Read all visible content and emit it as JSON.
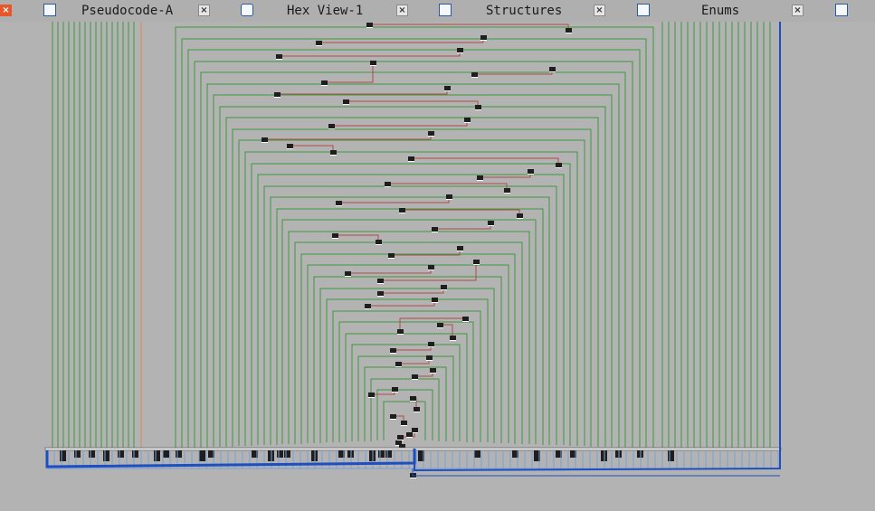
{
  "window": {
    "active_close_label": "×"
  },
  "tabs": [
    {
      "label": "Pseudocode-A",
      "icon": "pseudocode-icon",
      "close": "×"
    },
    {
      "label": "Hex View-1",
      "icon": "hex-view-icon",
      "close": "×"
    },
    {
      "label": "Structures",
      "icon": "structures-icon",
      "close": "×"
    },
    {
      "label": "Enums",
      "icon": "enums-icon",
      "close": "×"
    }
  ],
  "graph_view": {
    "colors": {
      "background": "#b3b3b3",
      "false_edge": "#3f9a3f",
      "true_edge": "#b04848",
      "back_edge": "#1d4fc0",
      "highlight_edge": "#d8875a",
      "node": "#1e1e1e"
    }
  }
}
